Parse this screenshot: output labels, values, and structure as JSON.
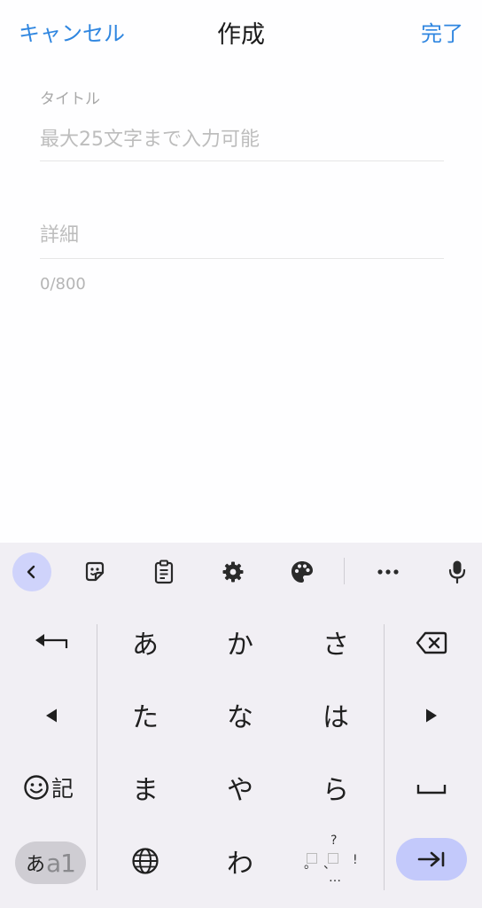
{
  "header": {
    "cancel_label": "キャンセル",
    "title": "作成",
    "done_label": "完了"
  },
  "form": {
    "title_label": "タイトル",
    "title_placeholder": "最大25文字まで入力可能",
    "title_value": "",
    "detail_placeholder": "詳細",
    "detail_value": "",
    "counter": "0/800"
  },
  "keyboard": {
    "toolbar_icons": [
      "chevron-left-icon",
      "sticker-icon",
      "clipboard-icon",
      "gear-icon",
      "palette-icon",
      "more-icon",
      "microphone-icon"
    ],
    "kana_rows": [
      [
        "あ",
        "か",
        "さ"
      ],
      [
        "た",
        "な",
        "は"
      ],
      [
        "ま",
        "や",
        "ら"
      ],
      [
        "",
        "わ",
        ""
      ]
    ],
    "emoji_kigou_label": "記",
    "mode_label_kana": "あ",
    "mode_label_alpha": "a1",
    "punct_marks": {
      "question": "?",
      "period": "。",
      "comma": "、",
      "exclaim": "!",
      "ellipsis": "…"
    },
    "colors": {
      "background": "#f1eff4",
      "accent": "#c3c9fb",
      "link": "#2f86e0"
    }
  }
}
